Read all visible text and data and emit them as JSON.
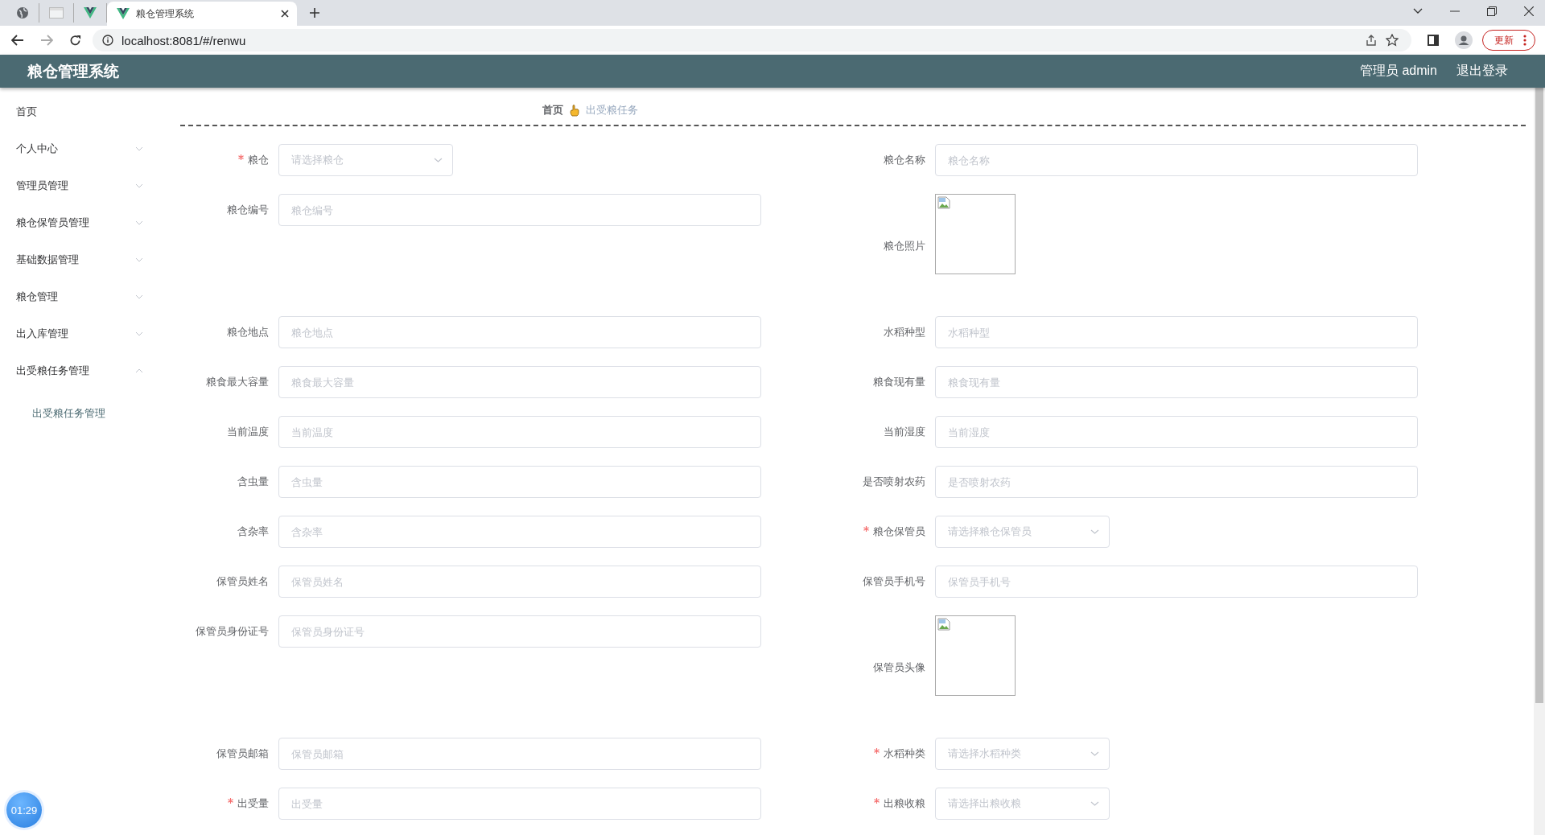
{
  "browser": {
    "tabs": [
      {
        "kind": "globe",
        "selected": false
      },
      {
        "kind": "page",
        "selected": false
      },
      {
        "kind": "vue",
        "selected": false
      },
      {
        "kind": "vue",
        "title": "粮仓管理系统",
        "selected": true
      }
    ],
    "address": "localhost:8081/#/renwu",
    "update_button": "更新"
  },
  "header": {
    "title": "粮仓管理系统",
    "user": "管理员 admin",
    "logout": "退出登录"
  },
  "sidebar": {
    "items": [
      {
        "label": "首页"
      },
      {
        "label": "个人中心",
        "expanded": false
      },
      {
        "label": "管理员管理",
        "expanded": false
      },
      {
        "label": "粮仓保管员管理",
        "expanded": false
      },
      {
        "label": "基础数据管理",
        "expanded": false
      },
      {
        "label": "粮仓管理",
        "expanded": false
      },
      {
        "label": "出入库管理",
        "expanded": false
      },
      {
        "label": "出受粮任务管理",
        "expanded": true,
        "children": [
          {
            "label": "出受粮任务管理"
          }
        ]
      }
    ]
  },
  "breadcrumb": {
    "home": "首页",
    "current": "出受粮任务"
  },
  "form": {
    "fields": [
      {
        "label": "粮仓",
        "required": true,
        "kind": "select",
        "placeholder": "请选择粮仓"
      },
      {
        "label": "粮仓名称",
        "required": false,
        "kind": "input",
        "placeholder": "粮仓名称"
      },
      {
        "label": "粮仓编号",
        "required": false,
        "kind": "input",
        "placeholder": "粮仓编号"
      },
      {
        "label": "粮仓照片",
        "required": false,
        "kind": "image"
      },
      {
        "label": "粮仓地点",
        "required": false,
        "kind": "input",
        "placeholder": "粮仓地点"
      },
      {
        "label": "水稻种型",
        "required": false,
        "kind": "input",
        "placeholder": "水稻种型"
      },
      {
        "label": "粮食最大容量",
        "required": false,
        "kind": "input",
        "placeholder": "粮食最大容量"
      },
      {
        "label": "粮食现有量",
        "required": false,
        "kind": "input",
        "placeholder": "粮食现有量"
      },
      {
        "label": "当前温度",
        "required": false,
        "kind": "input",
        "placeholder": "当前温度"
      },
      {
        "label": "当前湿度",
        "required": false,
        "kind": "input",
        "placeholder": "当前湿度"
      },
      {
        "label": "含虫量",
        "required": false,
        "kind": "input",
        "placeholder": "含虫量"
      },
      {
        "label": "是否喷射农药",
        "required": false,
        "kind": "input",
        "placeholder": "是否喷射农药"
      },
      {
        "label": "含杂率",
        "required": false,
        "kind": "input",
        "placeholder": "含杂率"
      },
      {
        "label": "粮仓保管员",
        "required": true,
        "kind": "select",
        "placeholder": "请选择粮仓保管员"
      },
      {
        "label": "保管员姓名",
        "required": false,
        "kind": "input",
        "placeholder": "保管员姓名"
      },
      {
        "label": "保管员手机号",
        "required": false,
        "kind": "input",
        "placeholder": "保管员手机号"
      },
      {
        "label": "保管员身份证号",
        "required": false,
        "kind": "input",
        "placeholder": "保管员身份证号"
      },
      {
        "label": "保管员头像",
        "required": false,
        "kind": "image"
      },
      {
        "label": "保管员邮箱",
        "required": false,
        "kind": "input",
        "placeholder": "保管员邮箱"
      },
      {
        "label": "水稻种类",
        "required": true,
        "kind": "select",
        "placeholder": "请选择水稻种类"
      },
      {
        "label": "出受量",
        "required": true,
        "kind": "input",
        "placeholder": "出受量"
      },
      {
        "label": "出粮收粮",
        "required": true,
        "kind": "select",
        "placeholder": "请选择出粮收粮"
      }
    ]
  },
  "timer": "01:29"
}
